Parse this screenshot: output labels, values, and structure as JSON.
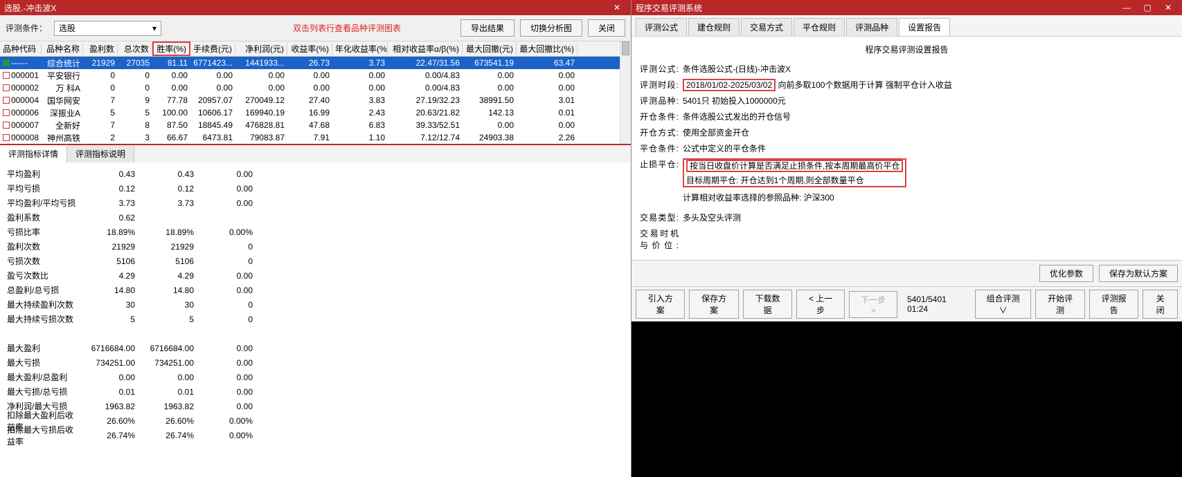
{
  "left": {
    "title": "选股.-冲击波X",
    "toolbar": {
      "label_cond": "评测条件：",
      "select_value": "选股",
      "red_note": "双击列表行查看品种评测图表",
      "btn_export": "导出结果",
      "btn_switch": "切换分析图",
      "btn_close": "关闭"
    },
    "table": {
      "headers": [
        "品种代码",
        "品种名称",
        "盈利数",
        "总次数",
        "胜率(%)",
        "手续费(元)",
        "净利润(元)",
        "收益率(%)",
        "年化收益率(%)",
        "相对收益率α/β(%)",
        "最大回撤(元)",
        "最大回撤比(%)"
      ],
      "rows": [
        {
          "sel": true,
          "sq": "green",
          "cells": [
            "------",
            "综合统计",
            "21929",
            "27035",
            "81.11",
            "6771423...",
            "1441933...",
            "26.73",
            "3.73",
            "22.47/31.56",
            "673541.19",
            "63.47"
          ]
        },
        {
          "sel": false,
          "sq": "",
          "cells": [
            "000001",
            "平安银行",
            "0",
            "0",
            "0.00",
            "0.00",
            "0.00",
            "0.00",
            "0.00",
            "0.00/4.83",
            "0.00",
            "0.00"
          ]
        },
        {
          "sel": false,
          "sq": "",
          "cells": [
            "000002",
            "万 科A",
            "0",
            "0",
            "0.00",
            "0.00",
            "0.00",
            "0.00",
            "0.00",
            "0.00/4.83",
            "0.00",
            "0.00"
          ]
        },
        {
          "sel": false,
          "sq": "",
          "cells": [
            "000004",
            "国华网安",
            "7",
            "9",
            "77.78",
            "20957.07",
            "270049.12",
            "27.40",
            "3.83",
            "27.19/32.23",
            "38991.50",
            "3.01"
          ]
        },
        {
          "sel": false,
          "sq": "",
          "cells": [
            "000006",
            "深振业A",
            "5",
            "5",
            "100.00",
            "10606.17",
            "169940.19",
            "16.99",
            "2.43",
            "20.63/21.82",
            "142.13",
            "0.01"
          ]
        },
        {
          "sel": false,
          "sq": "",
          "cells": [
            "000007",
            "全新好",
            "7",
            "8",
            "87.50",
            "18845.49",
            "476828.81",
            "47.68",
            "6.83",
            "39.33/52.51",
            "0.00",
            "0.00"
          ]
        },
        {
          "sel": false,
          "sq": "",
          "cells": [
            "000008",
            "神州高铁",
            "2",
            "3",
            "66.67",
            "6473.81",
            "79083.87",
            "7.91",
            "1.10",
            "7.12/12.74",
            "24903.38",
            "2.26"
          ]
        }
      ]
    },
    "tabs": {
      "tab1": "评测指标详情",
      "tab2": "评测指标说明"
    },
    "metrics": [
      {
        "name": "平均盈利",
        "v": [
          "0.43",
          "0.43",
          "0.00"
        ]
      },
      {
        "name": "平均亏损",
        "v": [
          "0.12",
          "0.12",
          "0.00"
        ]
      },
      {
        "name": "平均盈利/平均亏损",
        "v": [
          "3.73",
          "3.73",
          "0.00"
        ]
      },
      {
        "name": "盈利系数",
        "v": [
          "0.62",
          "",
          ""
        ]
      },
      {
        "name": "亏损比率",
        "v": [
          "18.89%",
          "18.89%",
          "0.00%"
        ]
      },
      {
        "name": "盈利次数",
        "v": [
          "21929",
          "21929",
          "0"
        ]
      },
      {
        "name": "亏损次数",
        "v": [
          "5106",
          "5106",
          "0"
        ]
      },
      {
        "name": "盈亏次数比",
        "v": [
          "4.29",
          "4.29",
          "0.00"
        ]
      },
      {
        "name": "总盈利/总亏损",
        "v": [
          "14.80",
          "14.80",
          "0.00"
        ]
      },
      {
        "name": "最大持续盈利次数",
        "v": [
          "30",
          "30",
          "0"
        ]
      },
      {
        "name": "最大持续亏损次数",
        "v": [
          "5",
          "5",
          "0"
        ]
      },
      {
        "name": "",
        "v": [
          "",
          "",
          ""
        ]
      },
      {
        "name": "最大盈利",
        "v": [
          "6716684.00",
          "6716684.00",
          "0.00"
        ]
      },
      {
        "name": "最大亏损",
        "v": [
          "734251.00",
          "734251.00",
          "0.00"
        ]
      },
      {
        "name": "最大盈利/总盈利",
        "v": [
          "0.00",
          "0.00",
          "0.00"
        ]
      },
      {
        "name": "最大亏损/总亏损",
        "v": [
          "0.01",
          "0.01",
          "0.00"
        ]
      },
      {
        "name": "净利润/最大亏损",
        "v": [
          "1963.82",
          "1963.82",
          "0.00"
        ]
      },
      {
        "name": "扣除最大盈利后收益率",
        "v": [
          "26.60%",
          "26.60%",
          "0.00%"
        ]
      },
      {
        "name": "扣除最大亏损后收益率",
        "v": [
          "26.74%",
          "26.74%",
          "0.00%"
        ]
      }
    ]
  },
  "right": {
    "title": "程序交易评测系统",
    "tabs": [
      "评测公式",
      "建仓规则",
      "交易方式",
      "平仓规则",
      "评测品种",
      "设置报告"
    ],
    "active_tab": 5,
    "report": {
      "heading": "程序交易评测设置报告",
      "rows": [
        {
          "label": "评测公式:",
          "value": "条件选股公式-(日线)-冲击波X",
          "hl": false
        },
        {
          "label": "评测时段:",
          "value": "2018/01/02-2025/03/02",
          "suffix": "向前多取100个数据用于计算 强制平仓计入收益",
          "hl": true
        },
        {
          "label": "评测品种:",
          "value": "5401只 初始投入1000000元",
          "hl": false
        },
        {
          "label": "开仓条件:",
          "value": "条件选股公式发出的开仓信号",
          "hl": false
        },
        {
          "label": "开仓方式:",
          "value": "使用全部资金开仓",
          "hl": false
        },
        {
          "label": "平仓条件:",
          "value": "公式中定义的平仓条件",
          "hl": false
        },
        {
          "label": "止损平仓:",
          "value": "按当日收盘价计算是否满足止损条件,按本周期最高价平仓",
          "hl": true,
          "ml": "目标周期平仓: 开仓达到1个周期,则全部数量平仓"
        },
        {
          "label": "",
          "value": "计算相对收益率选择的参照品种: 沪深300",
          "hl": false
        },
        {
          "label": "",
          "value": "",
          "hl": false
        },
        {
          "label": "交易类型:",
          "value": "多头及空头评测",
          "hl": false
        },
        {
          "label": "交易时机与价位:",
          "value": "",
          "hl": false
        }
      ]
    },
    "footer": {
      "btn_opt": "优化参数",
      "btn_save_default": "保存为默认方案"
    },
    "bottom": {
      "btn_import": "引入方案",
      "btn_save": "保存方案",
      "btn_download": "下载数据",
      "btn_prev": "< 上一步",
      "btn_next": "下一步 >",
      "progress": "5401/5401 01:24",
      "btn_combo": "组合评测∨",
      "btn_start": "开始评测",
      "btn_report": "评测报告",
      "btn_close": "关闭"
    }
  }
}
